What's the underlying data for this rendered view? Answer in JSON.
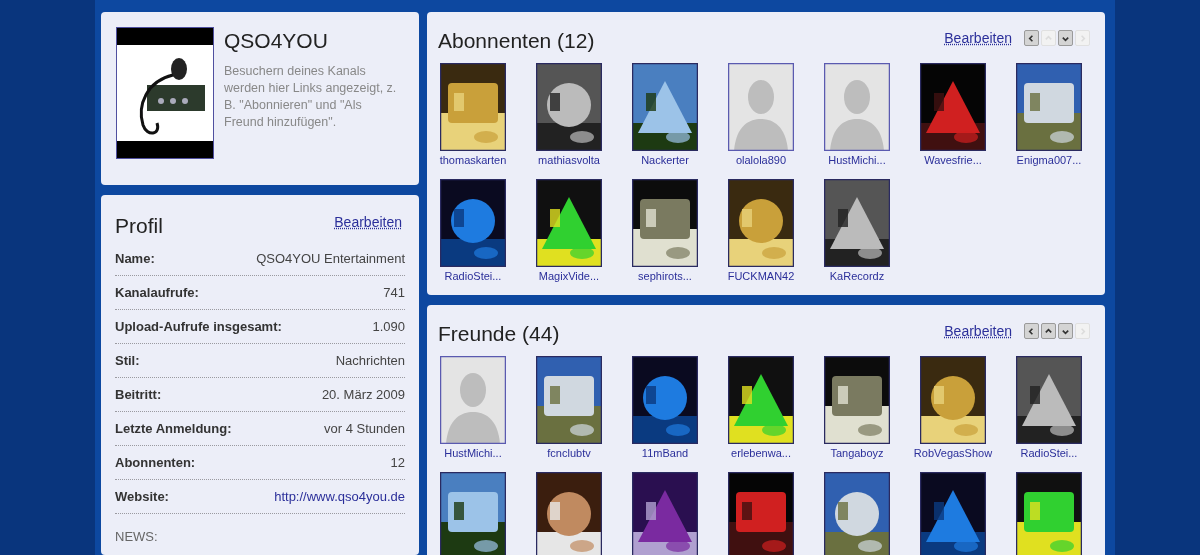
{
  "channel": {
    "title": "QSO4YOU",
    "description": "Besuchern deines Kanals werden hier Links angezeigt, z. B. \"Abonnieren\" und \"Als Freund hinzufügen\"."
  },
  "profile": {
    "title": "Profil",
    "edit": "Bearbeiten",
    "rows": [
      {
        "label": "Name:",
        "value": "QSO4YOU Entertainment",
        "kind": "text"
      },
      {
        "label": "Kanalaufrufe:",
        "value": "741",
        "kind": "text"
      },
      {
        "label": "Upload-Aufrufe insgesamt:",
        "value": "1.090",
        "kind": "text"
      },
      {
        "label": "Stil:",
        "value": "Nachrichten",
        "kind": "text"
      },
      {
        "label": "Beitritt:",
        "value": "20. März 2009",
        "kind": "text"
      },
      {
        "label": "Letzte Anmeldung:",
        "value": "vor 4 Stunden",
        "kind": "text"
      },
      {
        "label": "Abonnenten:",
        "value": "12",
        "kind": "text"
      },
      {
        "label": "Website:",
        "value": "http://www.qso4you.de",
        "kind": "link"
      }
    ],
    "news": "NEWS:"
  },
  "panels": [
    {
      "title": "Abonnenten (12)",
      "edit": "Bearbeiten",
      "nav": [
        {
          "disabled": false
        },
        {
          "disabled": true
        },
        {
          "disabled": false
        },
        {
          "disabled": true
        }
      ],
      "items": [
        {
          "name": "thomaskarten",
          "kind": "picture"
        },
        {
          "name": "mathiasvolta",
          "kind": "picture"
        },
        {
          "name": "Nackerter",
          "kind": "picture"
        },
        {
          "name": "olalola890",
          "kind": "default_avatar"
        },
        {
          "name": "HustMichi...",
          "kind": "default_avatar"
        },
        {
          "name": "Wavesfrie...",
          "kind": "picture"
        },
        {
          "name": "Enigma007...",
          "kind": "picture"
        },
        {
          "name": "RadioStei...",
          "kind": "picture"
        },
        {
          "name": "MagixVide...",
          "kind": "picture"
        },
        {
          "name": "sephirots...",
          "kind": "picture"
        },
        {
          "name": "FUCKMAN42",
          "kind": "picture"
        },
        {
          "name": "KaRecordz",
          "kind": "picture"
        }
      ]
    },
    {
      "title": "Freunde (44)",
      "edit": "Bearbeiten",
      "nav": [
        {
          "disabled": false
        },
        {
          "disabled": false
        },
        {
          "disabled": false
        },
        {
          "disabled": true
        }
      ],
      "items": [
        {
          "name": "HustMichi...",
          "kind": "default_avatar"
        },
        {
          "name": "fcnclubtv",
          "kind": "picture"
        },
        {
          "name": "11mBand",
          "kind": "picture"
        },
        {
          "name": "erlebenwa...",
          "kind": "picture"
        },
        {
          "name": "Tangaboyz",
          "kind": "picture"
        },
        {
          "name": "RobVegasShow",
          "kind": "picture"
        },
        {
          "name": "RadioStei...",
          "kind": "picture"
        },
        {
          "kind": "picture"
        },
        {
          "kind": "picture"
        },
        {
          "kind": "picture"
        },
        {
          "kind": "picture"
        },
        {
          "kind": "picture"
        },
        {
          "kind": "picture"
        },
        {
          "kind": "picture"
        }
      ]
    }
  ]
}
